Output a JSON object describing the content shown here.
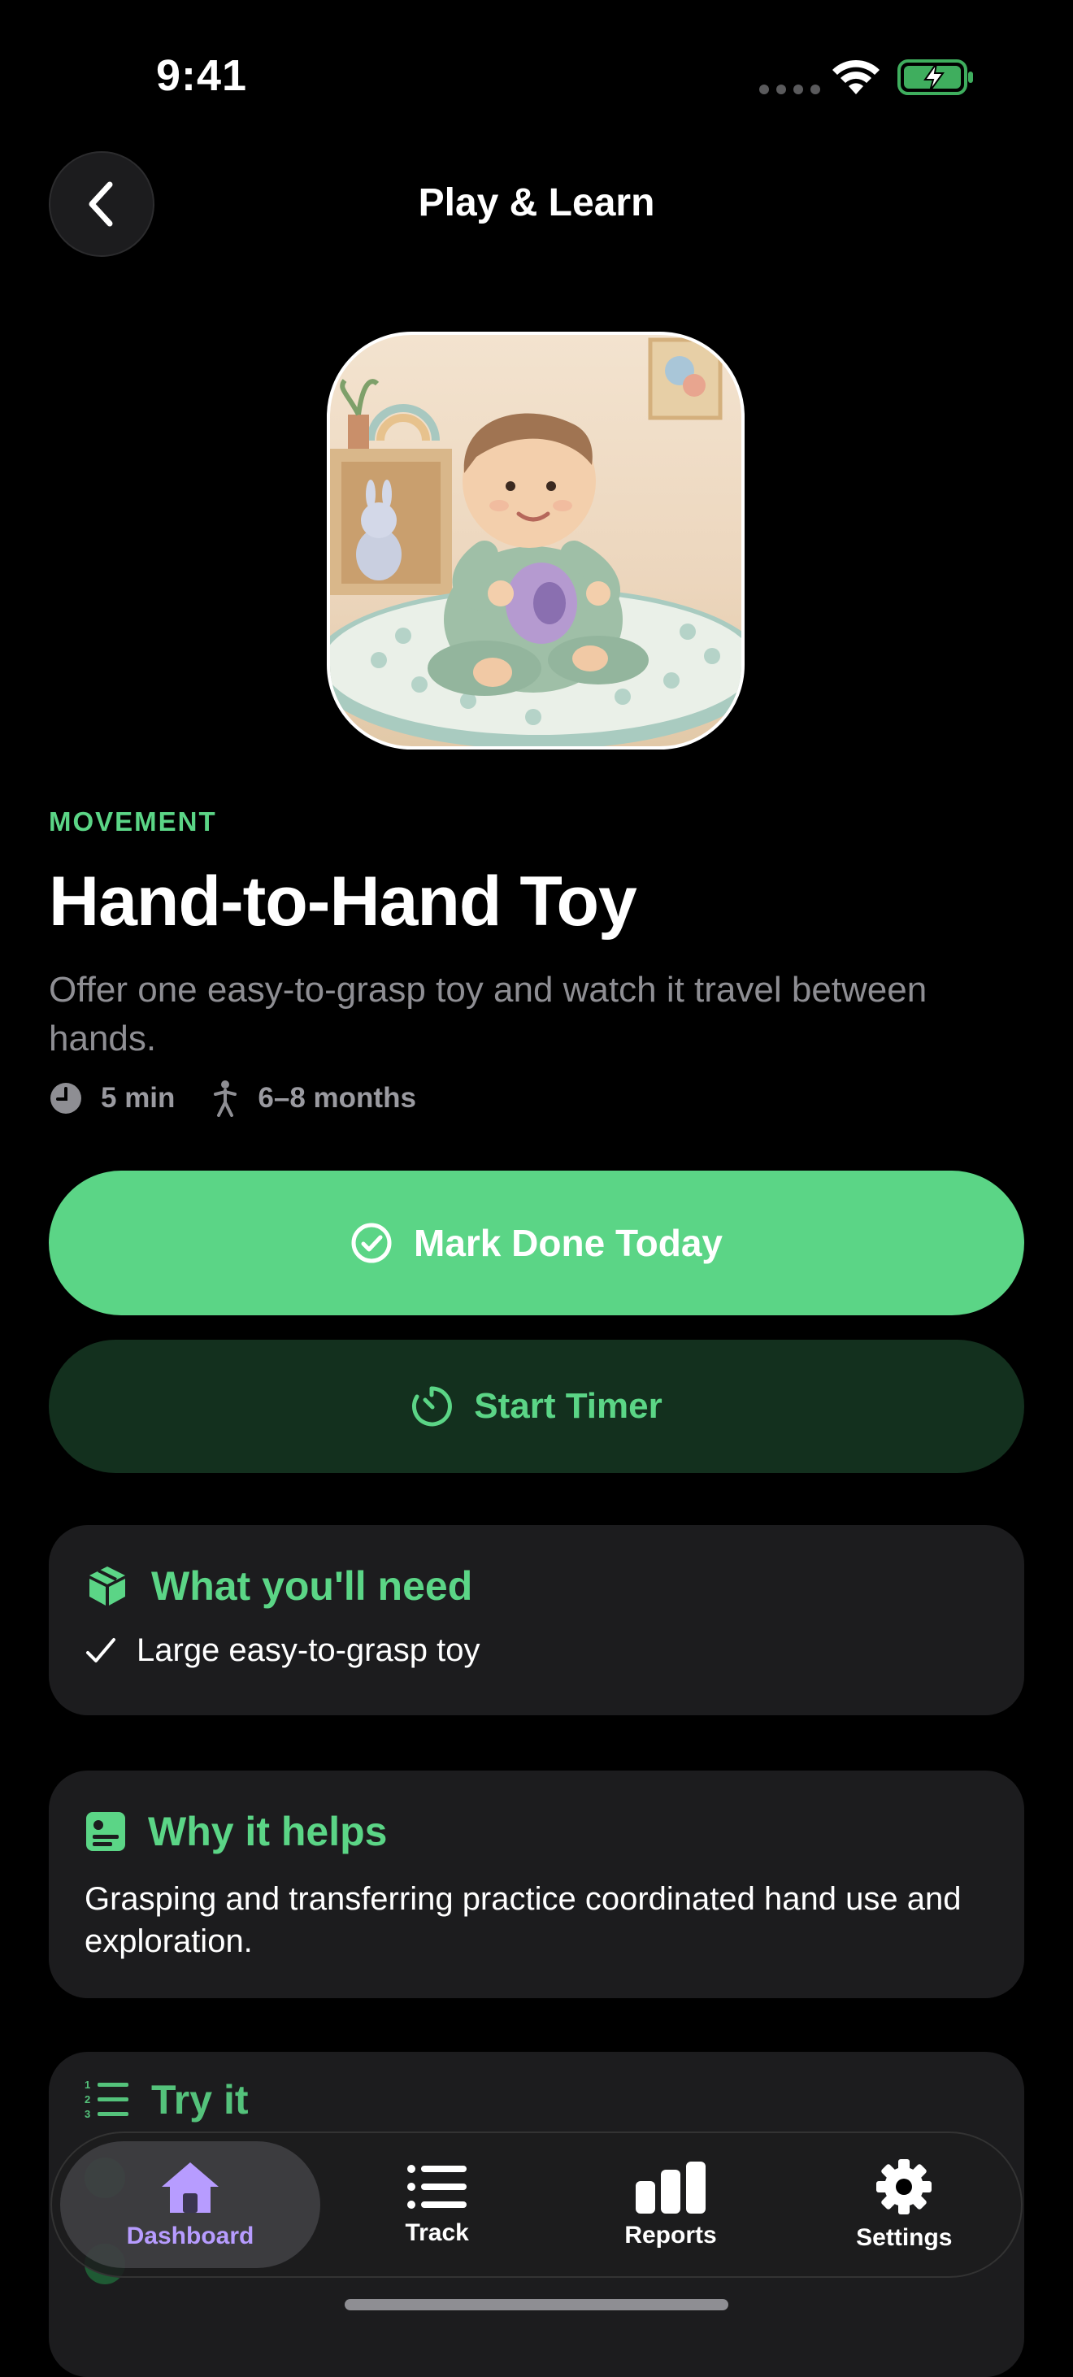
{
  "status": {
    "time": "9:41"
  },
  "nav": {
    "title": "Play & Learn",
    "back_icon": "chevron-left-icon"
  },
  "activity": {
    "category": "MOVEMENT",
    "title": "Hand-to-Hand Toy",
    "subtitle": "Offer one easy-to-grasp toy and watch it travel between hands.",
    "duration": "5 min",
    "age_range": "6–8 months"
  },
  "actions": {
    "mark_done": "Mark Done Today",
    "start_timer": "Start Timer"
  },
  "needs": {
    "heading": "What you'll need",
    "items": [
      "Large easy-to-grasp toy"
    ]
  },
  "why": {
    "heading": "Why it helps",
    "text": "Grasping and transferring practice coordinated hand use and exploration."
  },
  "try_it": {
    "heading": "Try it"
  },
  "tabs": [
    {
      "label": "Dashboard",
      "icon": "house-icon",
      "active": true
    },
    {
      "label": "Track",
      "icon": "list-icon"
    },
    {
      "label": "Reports",
      "icon": "bar-chart-icon"
    },
    {
      "label": "Settings",
      "icon": "gear-icon"
    }
  ],
  "colors": {
    "accent": "#5bd586",
    "active_tab": "#b79cff",
    "card": "#1c1c1e"
  }
}
